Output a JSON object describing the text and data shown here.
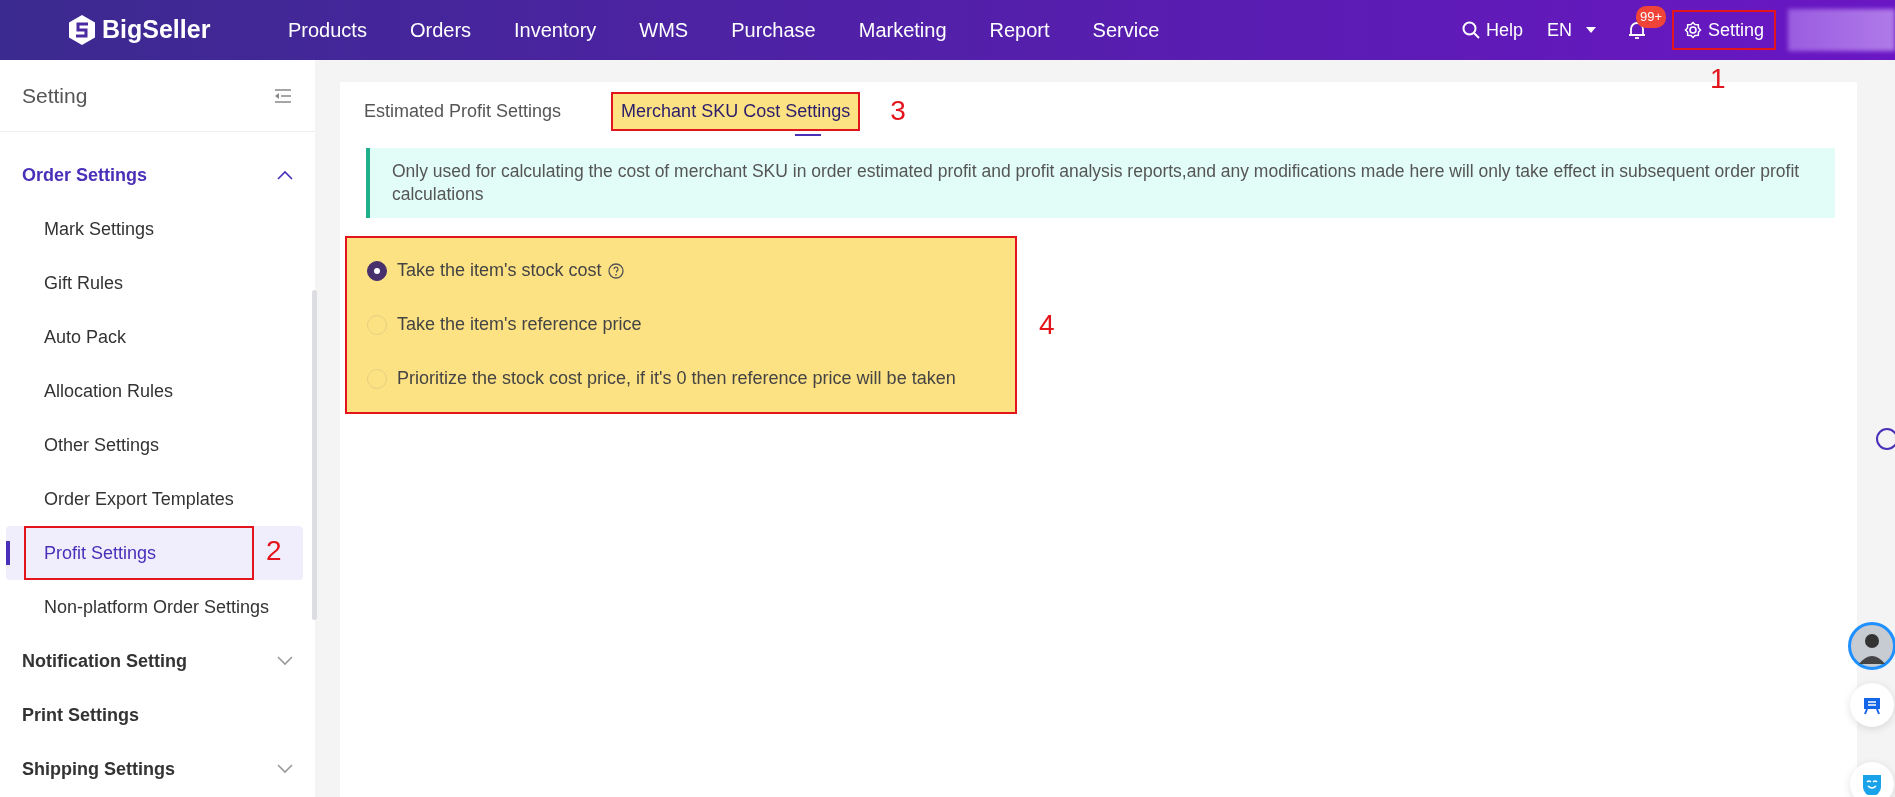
{
  "topbar": {
    "logo": "BigSeller",
    "menu": [
      "Products",
      "Orders",
      "Inventory",
      "WMS",
      "Purchase",
      "Marketing",
      "Report",
      "Service"
    ],
    "help": "Help",
    "language": "EN",
    "notification_badge": "99+",
    "setting": {
      "label": "Setting",
      "highlighted": true,
      "annotation": "1"
    }
  },
  "sidebar": {
    "title": "Setting",
    "groups": [
      {
        "label": "Order Settings",
        "expanded": true,
        "children": [
          {
            "label": "Mark Settings",
            "selected": false
          },
          {
            "label": "Gift Rules",
            "selected": false
          },
          {
            "label": "Auto Pack",
            "selected": false
          },
          {
            "label": "Allocation Rules",
            "selected": false
          },
          {
            "label": "Other Settings",
            "selected": false
          },
          {
            "label": "Order Export Templates",
            "selected": false
          },
          {
            "label": "Profit Settings",
            "selected": true,
            "highlighted": true,
            "annotation": "2"
          },
          {
            "label": "Non-platform Order Settings",
            "selected": false
          }
        ]
      },
      {
        "label": "Notification Setting",
        "expanded": false,
        "expandable": true
      },
      {
        "label": "Print Settings",
        "expanded": false,
        "expandable": false
      },
      {
        "label": "Shipping Settings",
        "expanded": false,
        "expandable": true
      }
    ]
  },
  "tabs": [
    {
      "label": "Estimated Profit Settings",
      "selected": false,
      "highlighted": false
    },
    {
      "label": "Merchant SKU Cost Settings",
      "selected": true,
      "highlighted": true,
      "annotation": "3"
    }
  ],
  "notice": "Only used for calculating the cost of merchant SKU in order estimated profit and profit analysis reports,and any modifications made here will only take effect in subsequent order profit calculations",
  "cost_options": {
    "highlighted": true,
    "annotation": "4",
    "options": [
      {
        "label": "Take the item's stock cost",
        "selected": true,
        "help": true
      },
      {
        "label": "Take the item's reference price",
        "selected": false,
        "help": false
      },
      {
        "label": "Prioritize the stock cost price, if it's 0 then reference price will be taken",
        "selected": false,
        "help": false
      }
    ]
  }
}
